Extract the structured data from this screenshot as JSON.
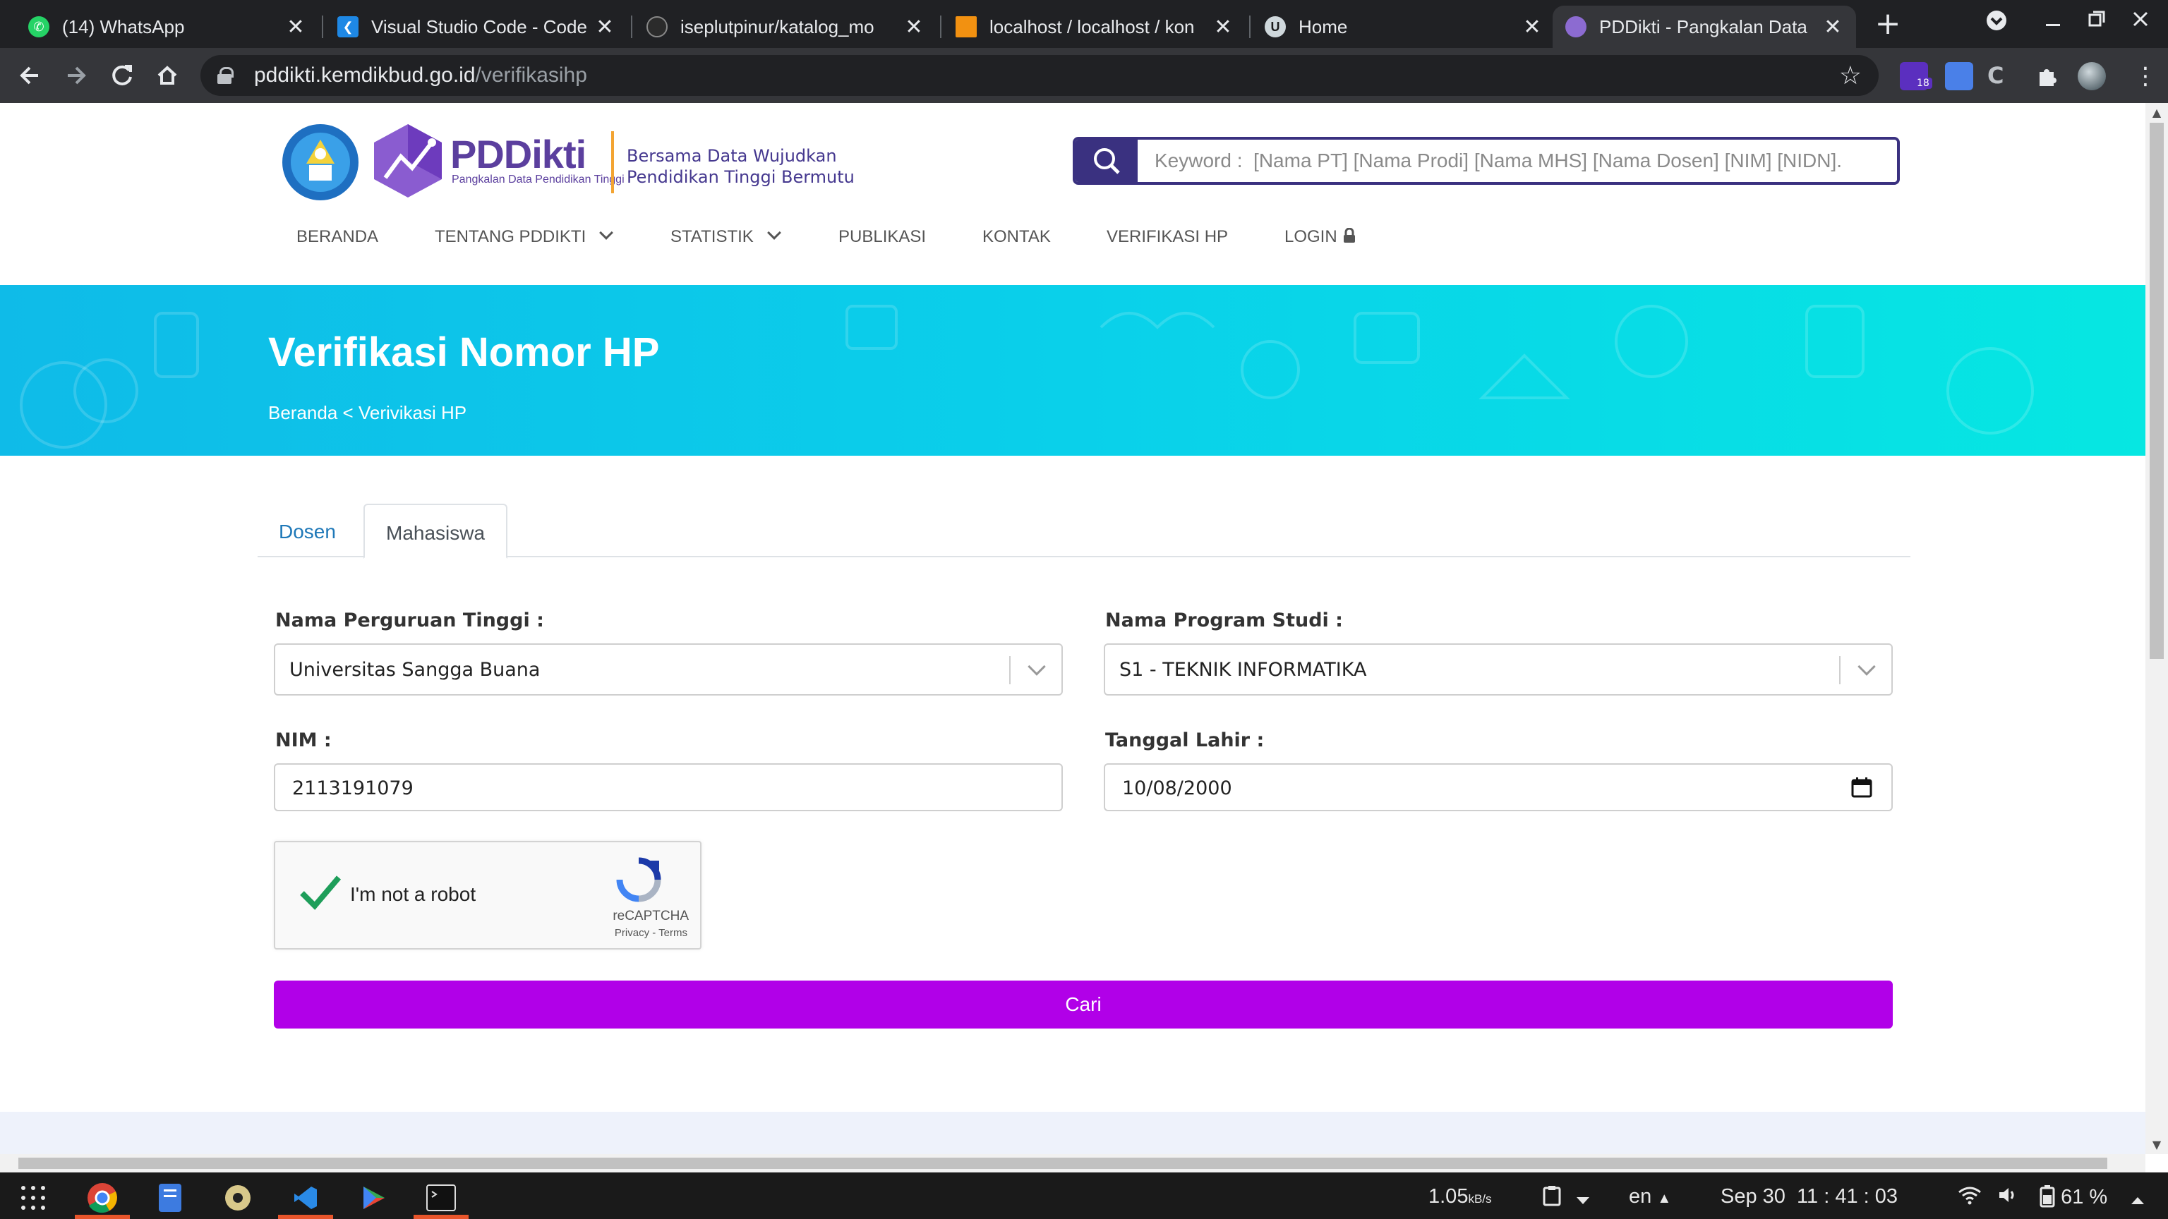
{
  "browser": {
    "tabs": [
      {
        "title": "(14) WhatsApp"
      },
      {
        "title": "Visual Studio Code - Code"
      },
      {
        "title": "iseplutpinur/katalog_mo"
      },
      {
        "title": "localhost / localhost / kon"
      },
      {
        "title": "Home"
      },
      {
        "title": "PDDikti - Pangkalan Data"
      }
    ],
    "close_glyph": "✕",
    "new_tab": "+",
    "url_host": "pddikti.kemdikbud.go.id",
    "url_path": "/verifikasihp",
    "extension_badge": "18"
  },
  "header": {
    "brand": "PDDikti",
    "brand_sub": "Pangkalan Data Pendidikan Tinggi",
    "tagline_line1": "Bersama Data Wujudkan",
    "tagline_line2": "Pendidikan Tinggi Bermutu",
    "search_placeholder": "Keyword :  [Nama PT] [Nama Prodi] [Nama MHS] [Nama Dosen] [NIM] [NIDN]."
  },
  "nav": {
    "items": [
      "BERANDA",
      "TENTANG PDDIKTI",
      "STATISTIK",
      "PUBLIKASI",
      "KONTAK",
      "VERIFIKASI HP",
      "LOGIN"
    ]
  },
  "hero": {
    "title": "Verifikasi Nomor HP",
    "breadcrumb_home": "Beranda",
    "breadcrumb_sep": "<",
    "breadcrumb_current": "Verivikasi HP"
  },
  "form": {
    "tabs": [
      "Dosen",
      "Mahasiswa"
    ],
    "active_tab": "Mahasiswa",
    "pt_label": "Nama Perguruan Tinggi :",
    "pt_value": "Universitas Sangga Buana",
    "prodi_label": "Nama Program Studi :",
    "prodi_value": "S1 - TEKNIK INFORMATIKA",
    "nim_label": "NIM :",
    "nim_value": "2113191079",
    "dob_label": "Tanggal Lahir :",
    "dob_value": "10/08/2000",
    "captcha_text": "I'm not a robot",
    "captcha_brand": "reCAPTCHA",
    "captcha_terms": "Privacy - Terms",
    "submit_label": "Cari"
  },
  "taskbar": {
    "net_speed": "1.05",
    "net_unit": "kB/s",
    "lang": "en",
    "date": "Sep 30",
    "time": "11 : 41 : 03",
    "battery": "61 %"
  },
  "colors": {
    "accent_purple": "#b100e8",
    "brand_indigo": "#3a3180",
    "hero_cyan": "#0fbbe8"
  }
}
